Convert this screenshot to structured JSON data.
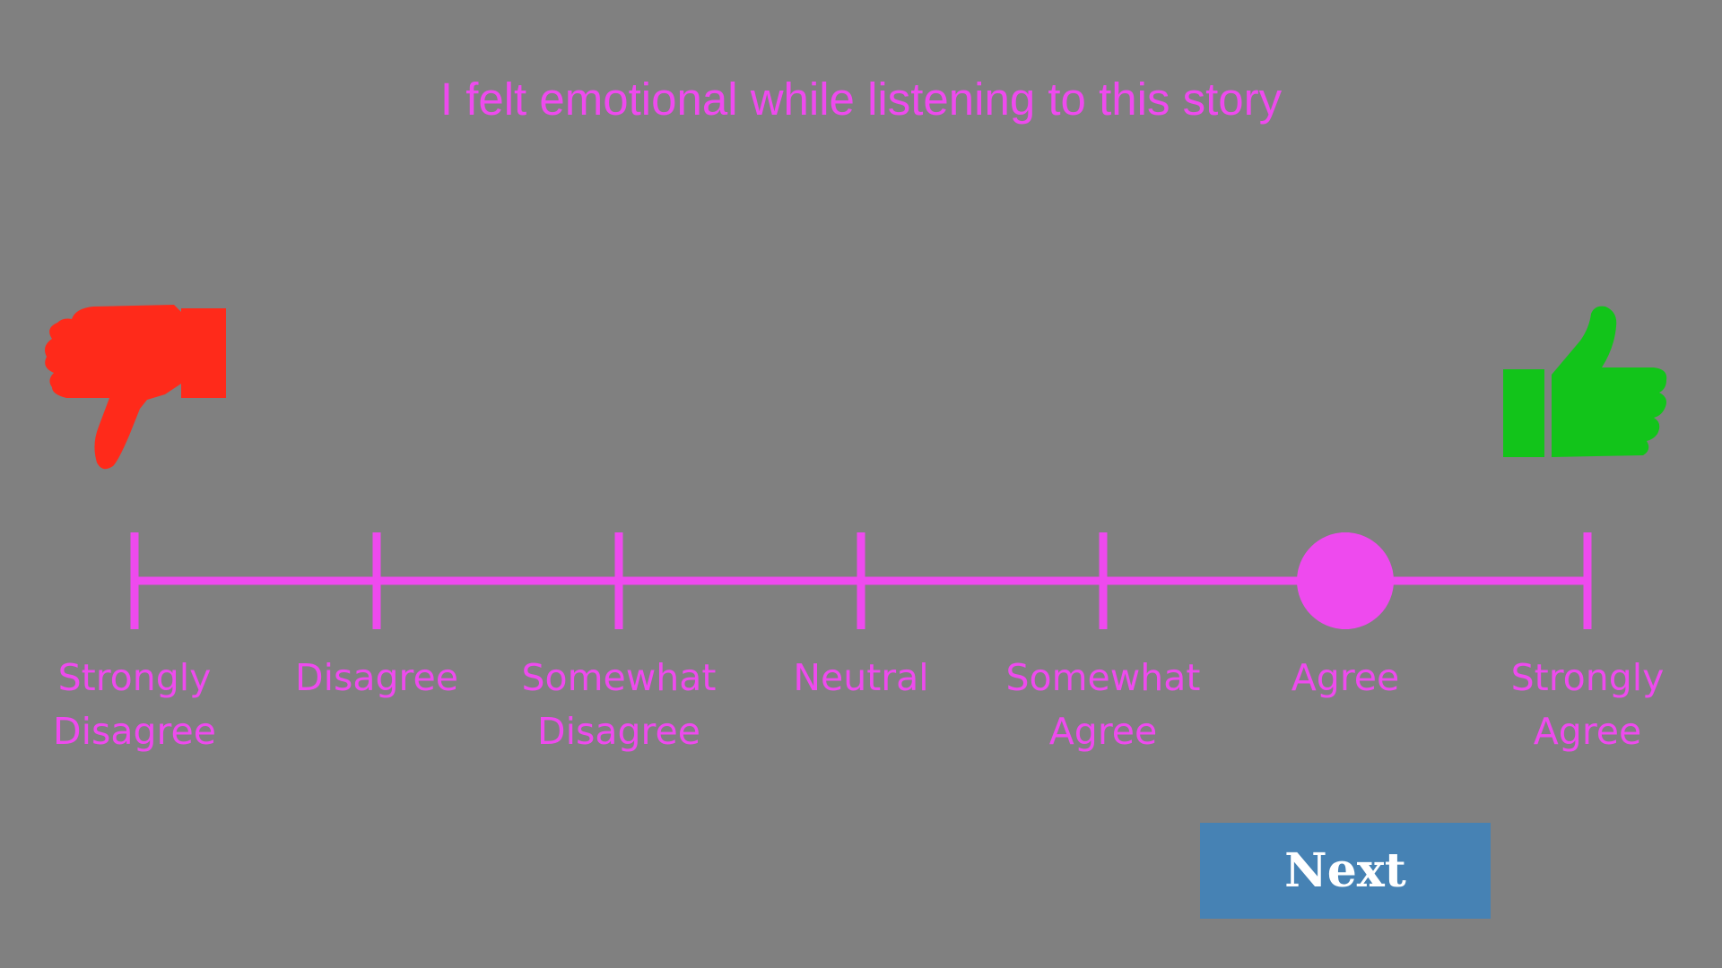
{
  "question": "I felt emotional while listening to this story",
  "scale": {
    "options": [
      {
        "line1": "Strongly",
        "line2": "Disagree"
      },
      {
        "line1": "Disagree",
        "line2": ""
      },
      {
        "line1": "Somewhat",
        "line2": "Disagree"
      },
      {
        "line1": "Neutral",
        "line2": ""
      },
      {
        "line1": "Somewhat",
        "line2": "Agree"
      },
      {
        "line1": "Agree",
        "line2": ""
      },
      {
        "line1": "Strongly",
        "line2": "Agree"
      }
    ],
    "selected_index": 5
  },
  "icons": {
    "left": "thumbs-down-icon",
    "right": "thumbs-up-icon"
  },
  "next_label": "Next",
  "colors": {
    "background": "#808080",
    "accent": "#ee4aee",
    "thumbs_down": "#ff2a1a",
    "thumbs_up": "#12c41a",
    "button": "#4682b4"
  }
}
